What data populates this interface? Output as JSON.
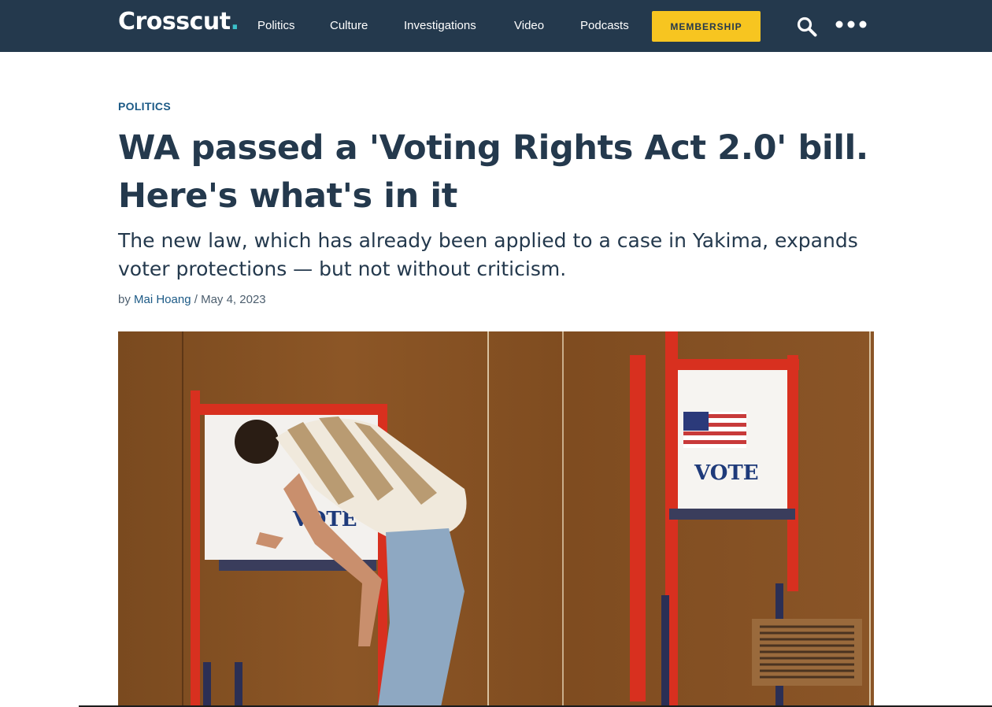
{
  "site": {
    "logo_text": "Crosscut",
    "logo_dot": ".",
    "nav": [
      {
        "label": "Politics"
      },
      {
        "label": "Culture"
      },
      {
        "label": "Investigations"
      },
      {
        "label": "Video"
      },
      {
        "label": "Podcasts"
      }
    ],
    "membership_label": "MEMBERSHIP",
    "search_icon": "search-icon",
    "more_icon": "more-dots-icon"
  },
  "article": {
    "section": "POLITICS",
    "title": "WA passed a 'Voting Rights Act 2.0' bill. Here's what's in it",
    "dek": "The new law, which has already been applied to a case in Yakima, expands voter protections — but not without criticism.",
    "byline_prefix": "by",
    "author": "Mai Hoang",
    "separator": "/",
    "date": "May 4, 2023"
  },
  "hero_image": {
    "sign_text_right": "VOTE",
    "sign_text_left": "VOTE"
  },
  "colors": {
    "nav_background": "#24394d",
    "logo_dot": "#3bc0c9",
    "membership_button": "#f7c520",
    "link": "#1c5a86",
    "headline": "#24394d"
  }
}
